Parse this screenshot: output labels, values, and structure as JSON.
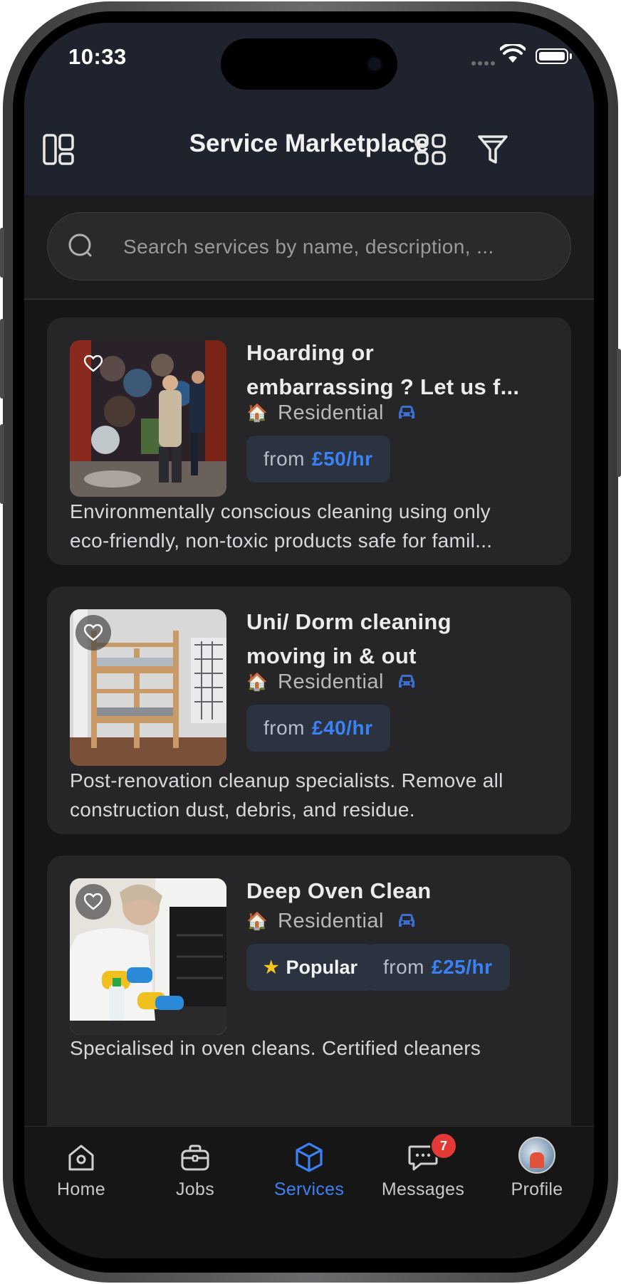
{
  "status_bar": {
    "time": "10:33"
  },
  "header": {
    "title": "Service Marketplace"
  },
  "search": {
    "placeholder": "Search services by name, description, ..."
  },
  "services": [
    {
      "title_line1": "Hoarding or",
      "title_line2": "embarrassing ? Let us f...",
      "category": "Residential",
      "price_prefix": "from",
      "price": "£50/hr",
      "desc_line1": "Environmentally conscious cleaning using only",
      "desc_line2": "eco-friendly, non-toxic products safe for famil..."
    },
    {
      "title_line1": "Uni/ Dorm cleaning",
      "title_line2": "moving in & out",
      "category": "Residential",
      "price_prefix": "from",
      "price": "£40/hr",
      "desc_line1": "Post-renovation cleanup specialists. Remove all",
      "desc_line2": "construction dust, debris, and residue."
    },
    {
      "title_line1": "Deep Oven Clean",
      "category": "Residential",
      "badge": "Popular",
      "price_prefix": "from",
      "price": "£25/hr",
      "desc_line1": "Specialised in oven cleans. Certified cleaners"
    }
  ],
  "tabs": [
    {
      "label": "Home",
      "icon": "home-icon"
    },
    {
      "label": "Jobs",
      "icon": "briefcase-icon"
    },
    {
      "label": "Services",
      "icon": "cube-icon",
      "active": true
    },
    {
      "label": "Messages",
      "icon": "chat-icon",
      "badge": "7"
    },
    {
      "label": "Profile",
      "icon": "avatar"
    }
  ],
  "colors": {
    "accent": "#3b82f6",
    "badge": "#e53935",
    "header_bg": "#1f232d",
    "card_bg": "#262628"
  }
}
